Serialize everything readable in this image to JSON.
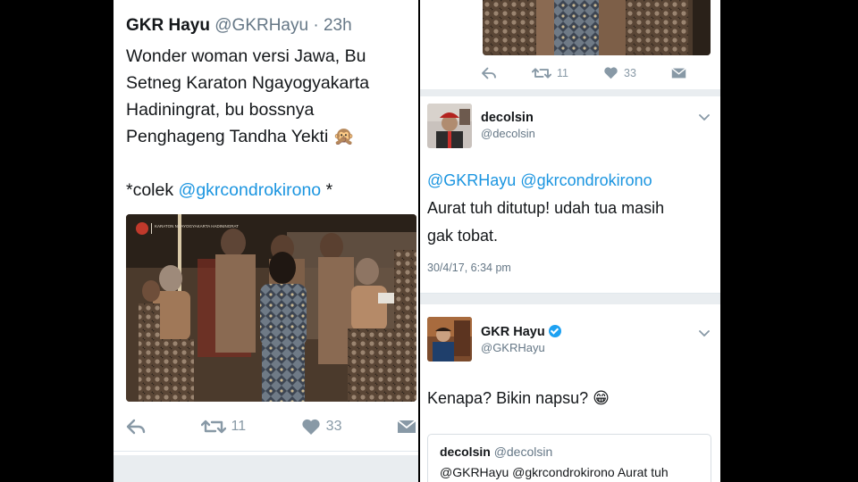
{
  "left_tweet": {
    "name": "GKR Hayu",
    "handle": "@GKRHayu",
    "time": "· 23h",
    "lines": [
      "Wonder woman versi Jawa, Bu",
      "Setneg Karaton Ngayogyakarta",
      "Hadiningrat, bu bossnya",
      "Penghageng Tandha Yekti 🙊"
    ],
    "colek_prefix": "*colek ",
    "colek_mention": "@gkrcondrokirono",
    "colek_suffix": " *",
    "photo_caption": "KARATON NGAYOGYAKARTA HADININGRAT",
    "actions": {
      "retweets": "11",
      "likes": "33"
    }
  },
  "right_top_actions": {
    "retweets": "11",
    "likes": "33"
  },
  "reply_decolsin": {
    "name": "decolsin",
    "handle": "@decolsin",
    "mention1": "@GKRHayu",
    "mention2": "@gkrcondrokirono",
    "line2": "Aurat tuh ditutup! udah tua masih",
    "line3": "gak tobat.",
    "date": "30/4/17, 6:34 pm"
  },
  "reply_hayu": {
    "name": "GKR Hayu",
    "handle": "@GKRHayu",
    "text": "Kenapa? Bikin napsu? 😁"
  },
  "quoted": {
    "name": "decolsin",
    "handle": "@decolsin",
    "text": "@GKRHayu @gkrcondrokirono Aurat tuh"
  },
  "colors": {
    "link": "#1b95e0",
    "muted": "#657786",
    "icon": "#8899a6",
    "verified": "#1da1f2"
  }
}
